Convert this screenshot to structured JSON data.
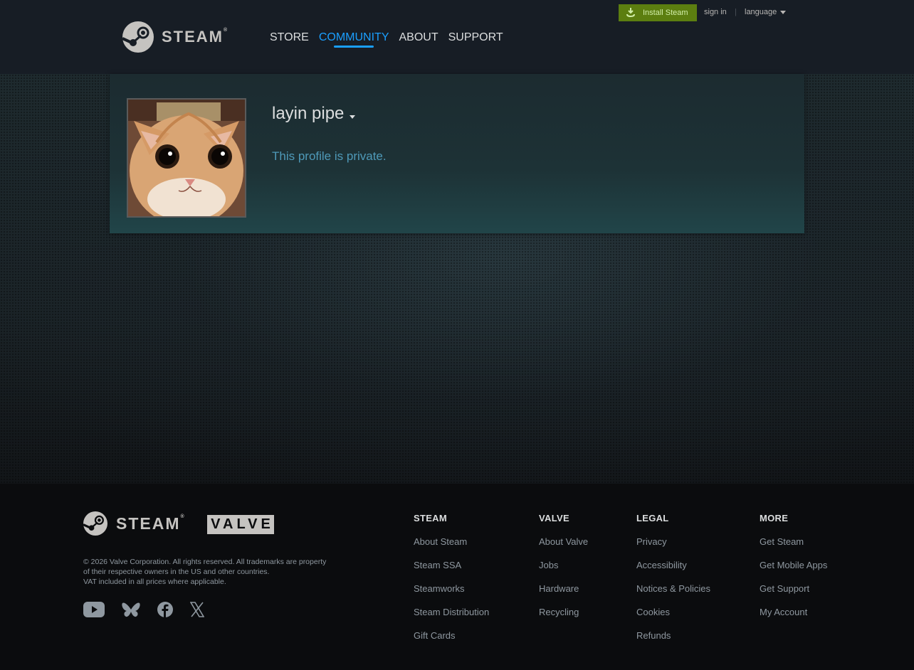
{
  "header": {
    "install_label": "Install Steam",
    "signin_label": "sign in",
    "separator": "|",
    "language_label": "language",
    "logo_text": "STEAM",
    "logo_reg": "®",
    "nav": [
      {
        "label": "STORE"
      },
      {
        "label": "COMMUNITY",
        "active": true
      },
      {
        "label": "ABOUT"
      },
      {
        "label": "SUPPORT"
      }
    ],
    "accent_color": "#1a9fff",
    "install_color": "#5c7e10"
  },
  "profile": {
    "persona_name": "layin pipe",
    "private_message": "This profile is private.",
    "avatar_icon": "cat-avatar"
  },
  "footer": {
    "logo_text": "STEAM",
    "logo_reg": "®",
    "valve_text": "VALVE",
    "copyright": "© 2026 Valve Corporation. All rights reserved. All trademarks are property of their respective owners in the US and other countries.",
    "vat": "VAT included in all prices where applicable.",
    "social_icons": [
      "youtube-icon",
      "bluesky-icon",
      "facebook-icon",
      "x-icon"
    ],
    "columns": [
      {
        "title": "STEAM",
        "links": [
          "About Steam",
          "Steam SSA",
          "Steamworks",
          "Steam Distribution",
          "Gift Cards"
        ]
      },
      {
        "title": "VALVE",
        "links": [
          "About Valve",
          "Jobs",
          "Hardware",
          "Recycling"
        ]
      },
      {
        "title": "LEGAL",
        "links": [
          "Privacy",
          "Accessibility",
          "Notices & Policies",
          "Cookies",
          "Refunds"
        ]
      },
      {
        "title": "MORE",
        "links": [
          "Get Steam",
          "Get Mobile Apps",
          "Get Support",
          "My Account"
        ]
      }
    ]
  }
}
